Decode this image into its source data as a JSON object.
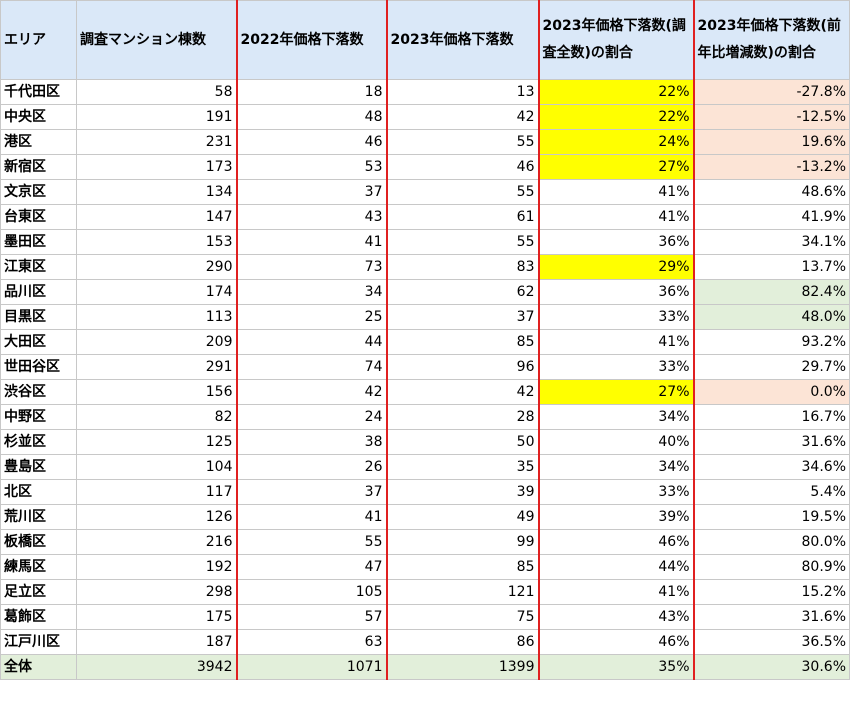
{
  "table": {
    "headers": [
      "エリア",
      "調査マンション棟数",
      "2022年価格下落数",
      "2023年価格下落数",
      "2023年価格下落数(調査全数)の割合",
      "2023年価格下落数(前年比増減数)の割合"
    ],
    "rows": [
      {
        "area": "千代田区",
        "count": "58",
        "d2022": "18",
        "d2023": "13",
        "ratio_all": "22%",
        "ratio_yoy": "-27.8%",
        "hl_all": "yellow",
        "hl_yoy": "pink"
      },
      {
        "area": "中央区",
        "count": "191",
        "d2022": "48",
        "d2023": "42",
        "ratio_all": "22%",
        "ratio_yoy": "-12.5%",
        "hl_all": "yellow",
        "hl_yoy": "pink"
      },
      {
        "area": "港区",
        "count": "231",
        "d2022": "46",
        "d2023": "55",
        "ratio_all": "24%",
        "ratio_yoy": "19.6%",
        "hl_all": "yellow",
        "hl_yoy": "pink"
      },
      {
        "area": "新宿区",
        "count": "173",
        "d2022": "53",
        "d2023": "46",
        "ratio_all": "27%",
        "ratio_yoy": "-13.2%",
        "hl_all": "yellow",
        "hl_yoy": "pink"
      },
      {
        "area": "文京区",
        "count": "134",
        "d2022": "37",
        "d2023": "55",
        "ratio_all": "41%",
        "ratio_yoy": "48.6%",
        "hl_all": "",
        "hl_yoy": ""
      },
      {
        "area": "台東区",
        "count": "147",
        "d2022": "43",
        "d2023": "61",
        "ratio_all": "41%",
        "ratio_yoy": "41.9%",
        "hl_all": "",
        "hl_yoy": ""
      },
      {
        "area": "墨田区",
        "count": "153",
        "d2022": "41",
        "d2023": "55",
        "ratio_all": "36%",
        "ratio_yoy": "34.1%",
        "hl_all": "",
        "hl_yoy": ""
      },
      {
        "area": "江東区",
        "count": "290",
        "d2022": "73",
        "d2023": "83",
        "ratio_all": "29%",
        "ratio_yoy": "13.7%",
        "hl_all": "yellow",
        "hl_yoy": ""
      },
      {
        "area": "品川区",
        "count": "174",
        "d2022": "34",
        "d2023": "62",
        "ratio_all": "36%",
        "ratio_yoy": "82.4%",
        "hl_all": "",
        "hl_yoy": "green"
      },
      {
        "area": "目黒区",
        "count": "113",
        "d2022": "25",
        "d2023": "37",
        "ratio_all": "33%",
        "ratio_yoy": "48.0%",
        "hl_all": "",
        "hl_yoy": "green"
      },
      {
        "area": "大田区",
        "count": "209",
        "d2022": "44",
        "d2023": "85",
        "ratio_all": "41%",
        "ratio_yoy": "93.2%",
        "hl_all": "",
        "hl_yoy": ""
      },
      {
        "area": "世田谷区",
        "count": "291",
        "d2022": "74",
        "d2023": "96",
        "ratio_all": "33%",
        "ratio_yoy": "29.7%",
        "hl_all": "",
        "hl_yoy": ""
      },
      {
        "area": "渋谷区",
        "count": "156",
        "d2022": "42",
        "d2023": "42",
        "ratio_all": "27%",
        "ratio_yoy": "0.0%",
        "hl_all": "yellow",
        "hl_yoy": "pink"
      },
      {
        "area": "中野区",
        "count": "82",
        "d2022": "24",
        "d2023": "28",
        "ratio_all": "34%",
        "ratio_yoy": "16.7%",
        "hl_all": "",
        "hl_yoy": ""
      },
      {
        "area": "杉並区",
        "count": "125",
        "d2022": "38",
        "d2023": "50",
        "ratio_all": "40%",
        "ratio_yoy": "31.6%",
        "hl_all": "",
        "hl_yoy": ""
      },
      {
        "area": "豊島区",
        "count": "104",
        "d2022": "26",
        "d2023": "35",
        "ratio_all": "34%",
        "ratio_yoy": "34.6%",
        "hl_all": "",
        "hl_yoy": ""
      },
      {
        "area": "北区",
        "count": "117",
        "d2022": "37",
        "d2023": "39",
        "ratio_all": "33%",
        "ratio_yoy": "5.4%",
        "hl_all": "",
        "hl_yoy": ""
      },
      {
        "area": "荒川区",
        "count": "126",
        "d2022": "41",
        "d2023": "49",
        "ratio_all": "39%",
        "ratio_yoy": "19.5%",
        "hl_all": "",
        "hl_yoy": ""
      },
      {
        "area": "板橋区",
        "count": "216",
        "d2022": "55",
        "d2023": "99",
        "ratio_all": "46%",
        "ratio_yoy": "80.0%",
        "hl_all": "",
        "hl_yoy": ""
      },
      {
        "area": "練馬区",
        "count": "192",
        "d2022": "47",
        "d2023": "85",
        "ratio_all": "44%",
        "ratio_yoy": "80.9%",
        "hl_all": "",
        "hl_yoy": ""
      },
      {
        "area": "足立区",
        "count": "298",
        "d2022": "105",
        "d2023": "121",
        "ratio_all": "41%",
        "ratio_yoy": "15.2%",
        "hl_all": "",
        "hl_yoy": ""
      },
      {
        "area": "葛飾区",
        "count": "175",
        "d2022": "57",
        "d2023": "75",
        "ratio_all": "43%",
        "ratio_yoy": "31.6%",
        "hl_all": "",
        "hl_yoy": ""
      },
      {
        "area": "江戸川区",
        "count": "187",
        "d2022": "63",
        "d2023": "86",
        "ratio_all": "46%",
        "ratio_yoy": "36.5%",
        "hl_all": "",
        "hl_yoy": ""
      }
    ],
    "total": {
      "area": "全体",
      "count": "3942",
      "d2022": "1071",
      "d2023": "1399",
      "ratio_all": "35%",
      "ratio_yoy": "30.6%"
    }
  },
  "colors": {
    "header_bg": "#dae8f8",
    "highlight_yellow": "#ffff00",
    "highlight_pink": "#fce4d6",
    "highlight_green": "#e2efda",
    "separator_red": "#e02020"
  }
}
